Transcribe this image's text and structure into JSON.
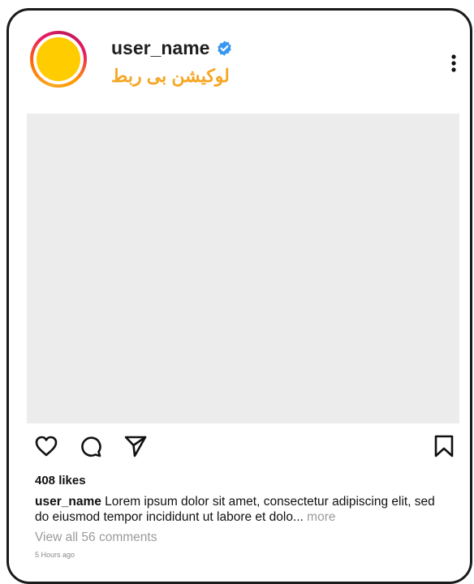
{
  "post": {
    "username": "user_name",
    "location": "لوکیشن بی ربط",
    "likes": "408 likes",
    "caption_user": "user_name",
    "caption_text": " Lorem ipsum dolor sit amet, consectetur adipiscing elit, sed do eiusmod tempor incididunt ut labore et dolo...",
    "caption_more": " more",
    "view_comments": "View all 56 comments",
    "timestamp": "5 Hours ago"
  },
  "icons": {
    "verified": "verified-badge-icon",
    "more": "more-options-icon",
    "like": "heart-icon",
    "comment": "comment-icon",
    "share": "share-icon",
    "save": "bookmark-icon"
  },
  "colors": {
    "avatar": "#ffcc00",
    "location": "#f5a623",
    "verified": "#3897f0",
    "image_placeholder": "#ececec"
  }
}
